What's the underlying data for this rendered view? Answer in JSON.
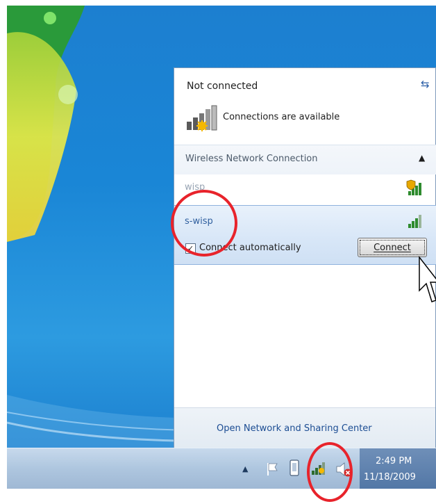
{
  "flyout": {
    "status": "Not connected",
    "available": "Connections are available",
    "section_title": "Wireless Network Connection",
    "networks": [
      {
        "name": "wisp"
      },
      {
        "name": "s-wisp"
      }
    ],
    "auto_connect_label": "Connect automatically",
    "auto_connect_checked": true,
    "connect_button": "Connect",
    "footer_link": "Open Network and Sharing Center"
  },
  "taskbar": {
    "time": "2:49 PM",
    "date": "11/18/2009"
  },
  "colors": {
    "desktop_blue": "#1a86d6",
    "highlight": "#e8232b",
    "selection": "#d7e6f7"
  },
  "icons": [
    "refresh-icon",
    "network-available-icon",
    "collapse-chevron-icon",
    "signal-secured-icon",
    "signal-icon",
    "show-hidden-icons-icon",
    "action-center-flag-icon",
    "power-icon",
    "network-tray-icon",
    "volume-muted-icon",
    "mouse-cursor-icon"
  ]
}
